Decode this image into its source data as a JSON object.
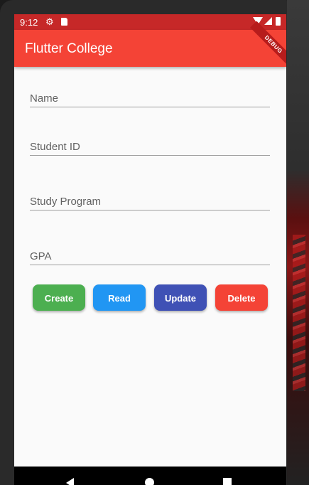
{
  "status_bar": {
    "time": "9:12",
    "icons": [
      "gear-icon",
      "sd-card-icon",
      "wifi-icon",
      "signal-icon",
      "battery-icon"
    ]
  },
  "app_bar": {
    "title": "Flutter College",
    "debug_banner": "DEBUG",
    "color": "#f44336"
  },
  "form": {
    "fields": [
      {
        "placeholder": "Name",
        "value": ""
      },
      {
        "placeholder": "Student ID",
        "value": ""
      },
      {
        "placeholder": "Study Program",
        "value": ""
      },
      {
        "placeholder": "GPA",
        "value": ""
      }
    ]
  },
  "actions": [
    {
      "label": "Create",
      "color": "#4caf50"
    },
    {
      "label": "Read",
      "color": "#2196f3"
    },
    {
      "label": "Update",
      "color": "#3f51b5"
    },
    {
      "label": "Delete",
      "color": "#f44336"
    }
  ],
  "nav_bar": {
    "icons": [
      "back-icon",
      "home-icon",
      "recents-icon"
    ]
  }
}
